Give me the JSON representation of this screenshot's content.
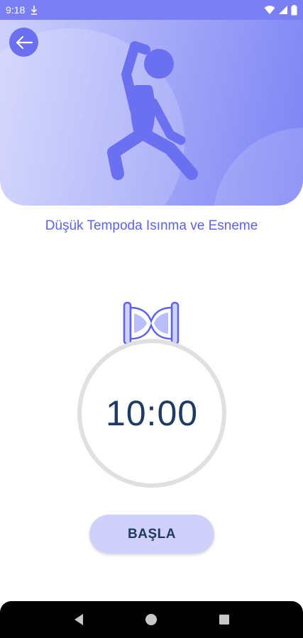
{
  "status_bar": {
    "time": "9:18",
    "icons": [
      "download-icon",
      "wifi-icon",
      "signal-icon",
      "battery-icon"
    ]
  },
  "header": {
    "back_icon": "arrow-left-icon",
    "illustration": "stretching-person-icon"
  },
  "workout": {
    "title": "Düşük Tempoda Isınma ve Esneme"
  },
  "timer": {
    "icon": "hourglass-icon",
    "time": "10:00"
  },
  "actions": {
    "start_label": "BAŞLA"
  },
  "nav_bar": {
    "back": "back-triangle-icon",
    "home": "home-circle-icon",
    "recents": "recents-square-icon"
  },
  "colors": {
    "accent": "#6a70f0",
    "title": "#5d63e8",
    "timer_text": "#1f3a63",
    "button_bg": "#cfd1fa"
  }
}
